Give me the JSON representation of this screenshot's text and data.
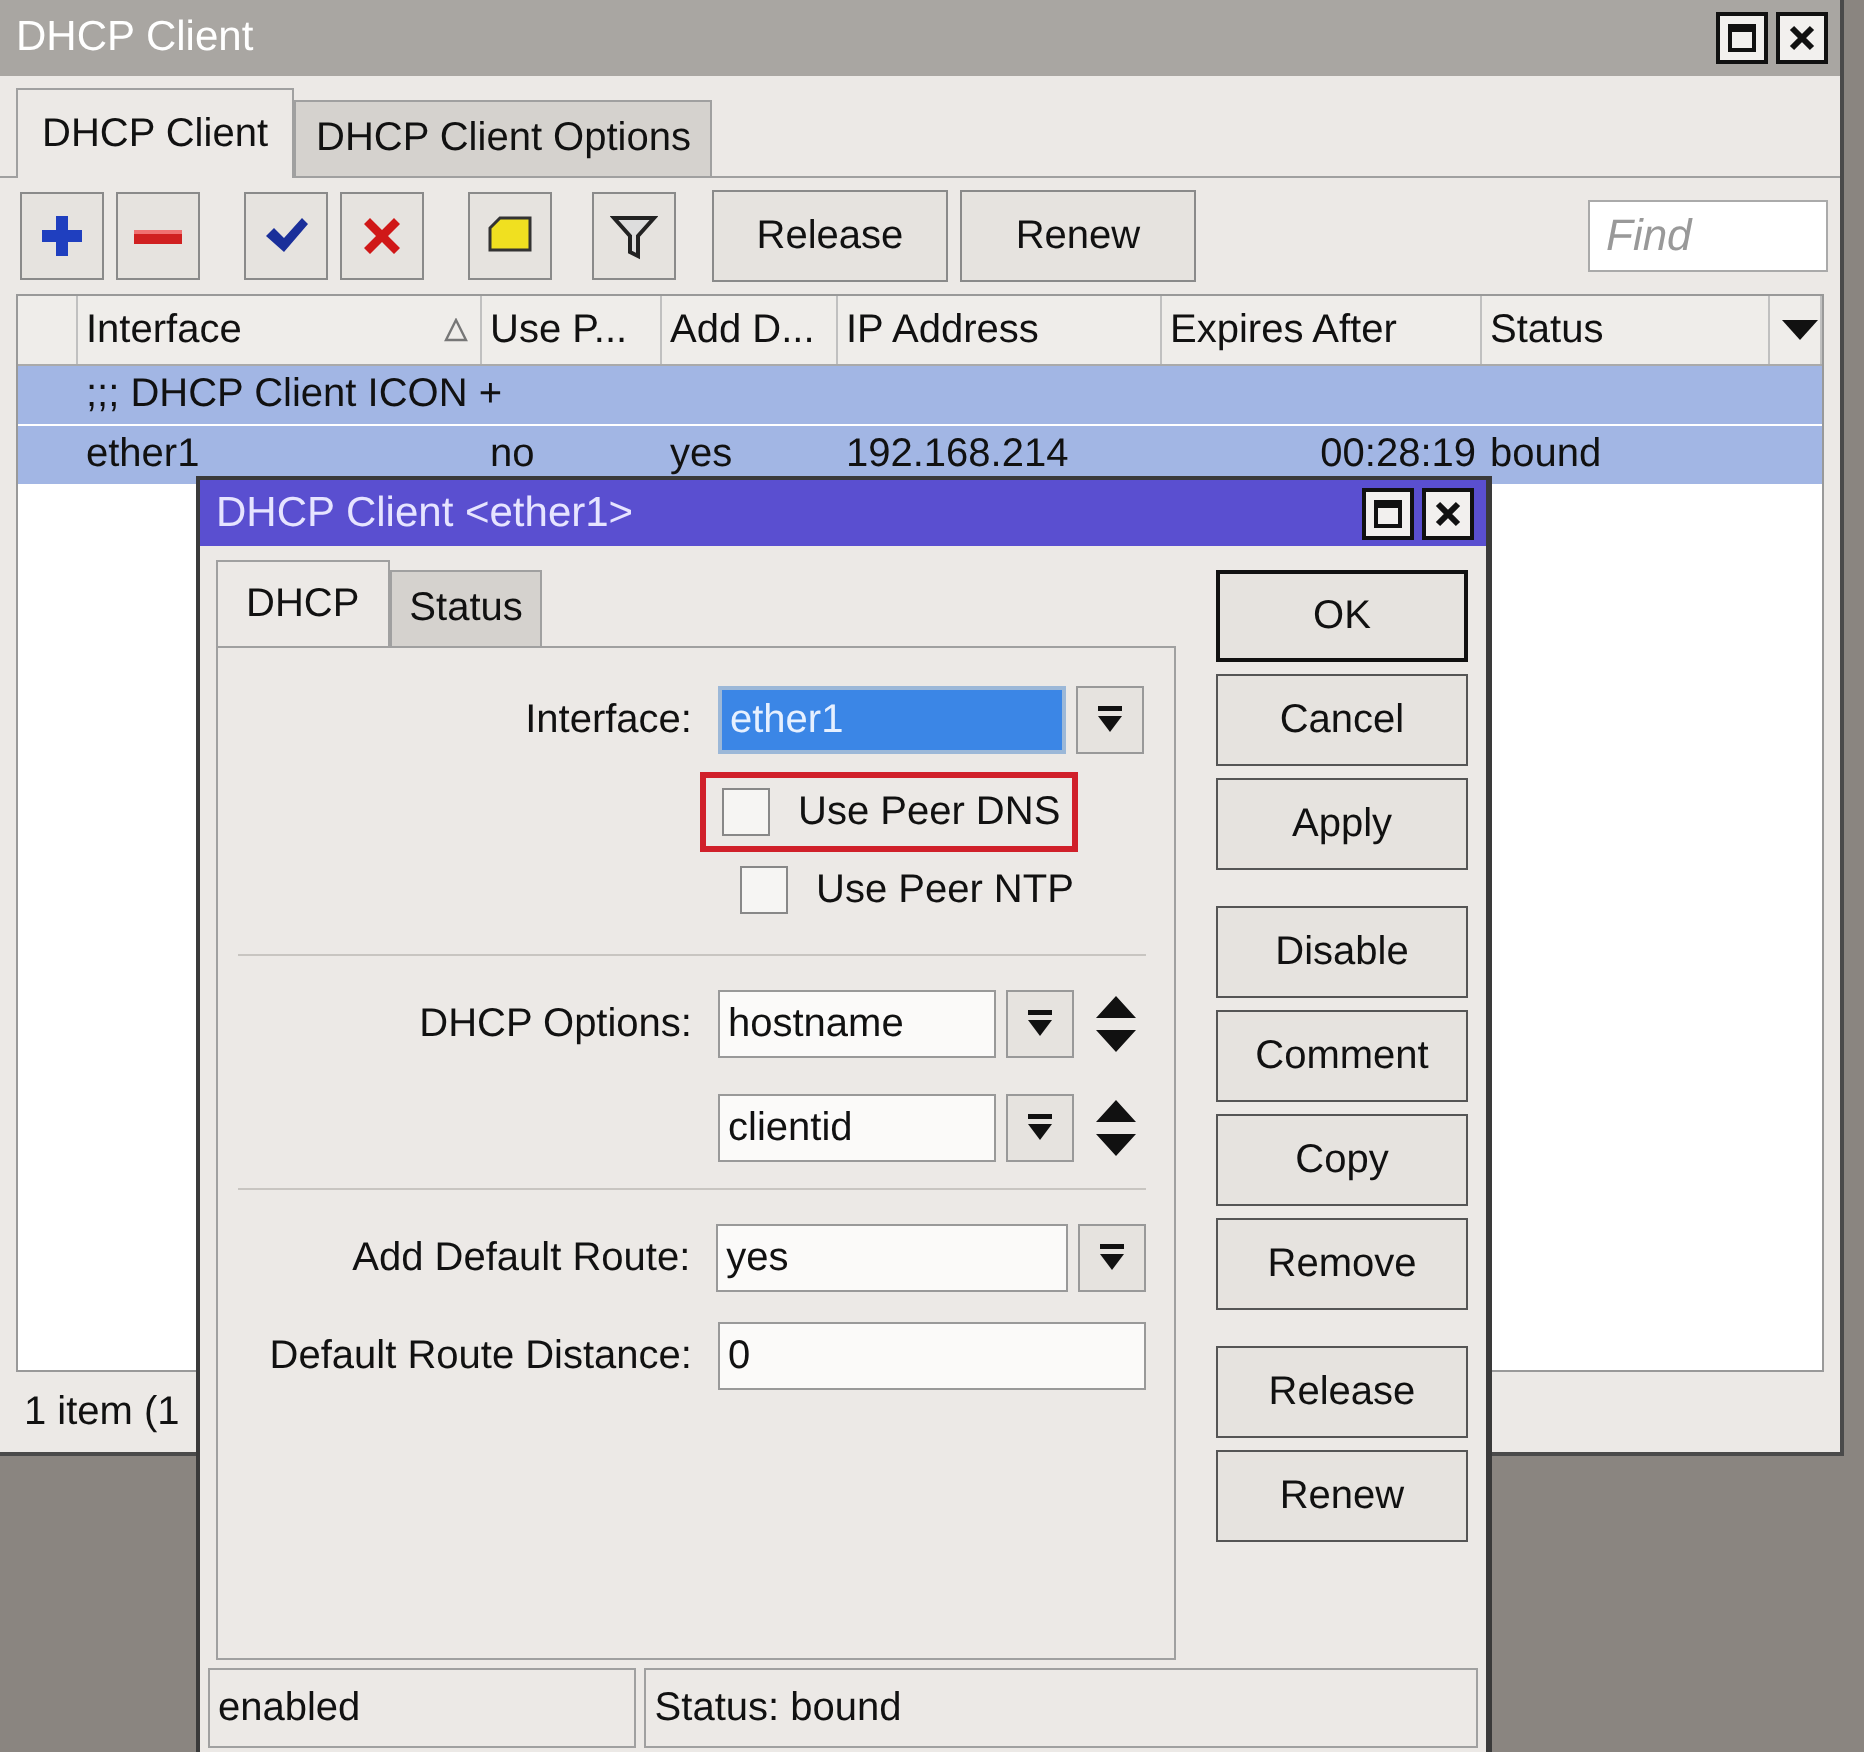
{
  "window": {
    "title": "DHCP Client"
  },
  "tabs": [
    {
      "label": "DHCP Client",
      "selected": true
    },
    {
      "label": "DHCP Client Options",
      "selected": false
    }
  ],
  "toolbar": {
    "icon_buttons": [
      {
        "kind": "add"
      },
      {
        "kind": "remove"
      },
      {
        "kind": "enable"
      },
      {
        "kind": "disable"
      },
      {
        "kind": "comment"
      },
      {
        "kind": "filter"
      }
    ],
    "text_buttons": [
      "Release",
      "Renew"
    ],
    "search": {
      "placeholder": "Find"
    }
  },
  "table": {
    "columns": [
      {
        "label": "Interface",
        "sorted": true
      },
      {
        "label": "Use P...",
        "sorted": false
      },
      {
        "label": "Add D...",
        "sorted": false
      },
      {
        "label": "IP Address",
        "sorted": false
      },
      {
        "label": "Expires After",
        "sorted": false
      },
      {
        "label": "Status",
        "sorted": false
      }
    ],
    "rows": [
      {
        "kind": "comment",
        "text": ";;; DHCP Client ICON +",
        "selected": true
      },
      {
        "kind": "entry",
        "cells": [
          "ether1",
          "no",
          "yes",
          "192.168.214",
          "00:28:19",
          "bound"
        ],
        "selected": true
      }
    ]
  },
  "status_bar": "1 item (1",
  "dialog": {
    "title": "DHCP Client <ether1>",
    "tabs": [
      {
        "label": "DHCP",
        "selected": true
      },
      {
        "label": "Status",
        "selected": false
      }
    ],
    "interface": {
      "label": "Interface:",
      "value": "ether1",
      "value_selected": true
    },
    "checkboxes": [
      {
        "label": "Use Peer DNS",
        "checked": false,
        "highlighted": true
      },
      {
        "label": "Use Peer NTP",
        "checked": false,
        "highlighted": false
      }
    ],
    "dhcp_options": {
      "label": "DHCP Options:",
      "values": [
        "hostname",
        "clientid"
      ]
    },
    "add_default_route": {
      "label": "Add Default Route:",
      "value": "yes"
    },
    "default_route_distance": {
      "label": "Default Route Distance:",
      "value": "0"
    },
    "button_groups": [
      [
        {
          "label": "OK",
          "default": true
        },
        {
          "label": "Cancel",
          "default": false
        },
        {
          "label": "Apply",
          "default": false
        }
      ],
      [
        {
          "label": "Disable",
          "default": false
        },
        {
          "label": "Comment",
          "default": false
        },
        {
          "label": "Copy",
          "default": false
        },
        {
          "label": "Remove",
          "default": false
        }
      ],
      [
        {
          "label": "Release",
          "default": false
        },
        {
          "label": "Renew",
          "default": false
        }
      ]
    ],
    "status_bar": [
      "enabled",
      "Status: bound"
    ]
  }
}
